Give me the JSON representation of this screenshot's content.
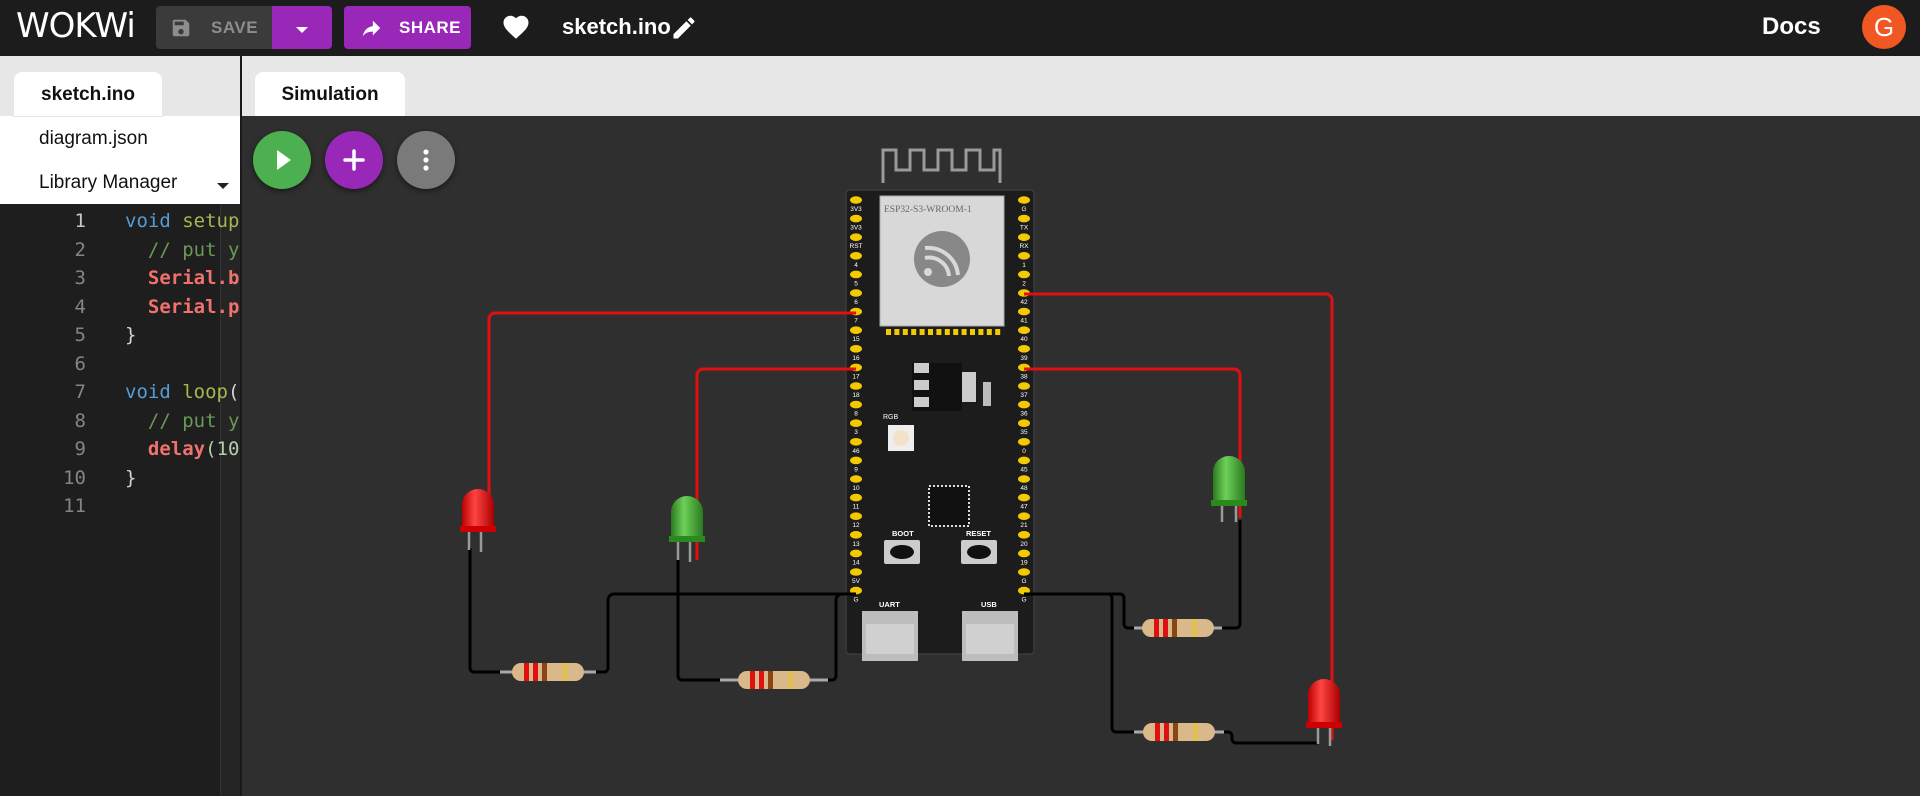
{
  "header": {
    "logo": "WOKWi",
    "save_label": "SAVE",
    "share_label": "SHARE",
    "project_name": "sketch.ino",
    "docs_label": "Docs",
    "avatar_letter": "G"
  },
  "editor": {
    "tabs": [
      {
        "label": "sketch.ino"
      },
      {
        "label": "diagram.json"
      },
      {
        "label": "Library Manager"
      }
    ],
    "line_numbers": [
      "1",
      "2",
      "3",
      "4",
      "5",
      "6",
      "7",
      "8",
      "9",
      "10",
      "11"
    ],
    "lines": [
      {
        "parts": [
          {
            "t": "void ",
            "c": "kw"
          },
          {
            "t": "setup",
            "c": "fn"
          }
        ]
      },
      {
        "parts": [
          {
            "t": "  // put y",
            "c": "cm"
          }
        ]
      },
      {
        "parts": [
          {
            "t": "  "
          },
          {
            "t": "Serial.b",
            "c": "obj"
          }
        ]
      },
      {
        "parts": [
          {
            "t": "  "
          },
          {
            "t": "Serial.p",
            "c": "obj"
          }
        ]
      },
      {
        "parts": [
          {
            "t": "}"
          }
        ]
      },
      {
        "parts": []
      },
      {
        "parts": [
          {
            "t": "void ",
            "c": "kw"
          },
          {
            "t": "loop",
            "c": "fn"
          },
          {
            "t": "("
          }
        ]
      },
      {
        "parts": [
          {
            "t": "  // put y",
            "c": "cm"
          }
        ]
      },
      {
        "parts": [
          {
            "t": "  "
          },
          {
            "t": "delay",
            "c": "obj"
          },
          {
            "t": "(10",
            "c": "num"
          }
        ]
      },
      {
        "parts": [
          {
            "t": "}"
          }
        ]
      },
      {
        "parts": []
      }
    ]
  },
  "simulation": {
    "tab_label": "Simulation",
    "board": {
      "module_label": "ESP32-S3-WROOM-1",
      "rgb_label": "RGB",
      "boot_label": "BOOT",
      "reset_label": "RESET",
      "uart_label": "UART",
      "usb_label": "USB",
      "left_pins": [
        "3V3",
        "3V3",
        "RST",
        "4",
        "5",
        "6",
        "7",
        "15",
        "16",
        "17",
        "18",
        "8",
        "3",
        "46",
        "9",
        "10",
        "11",
        "12",
        "13",
        "14",
        "5V",
        "G"
      ],
      "right_pins": [
        "G",
        "TX",
        "RX",
        "1",
        "2",
        "42",
        "41",
        "40",
        "39",
        "38",
        "37",
        "36",
        "35",
        "0",
        "45",
        "48",
        "47",
        "21",
        "20",
        "19",
        "G",
        "G"
      ]
    },
    "leds": [
      {
        "color": "red"
      },
      {
        "color": "green"
      },
      {
        "color": "green"
      },
      {
        "color": "red"
      }
    ]
  },
  "colors": {
    "accent_purple": "#9928b8",
    "play_green": "#4caf50",
    "avatar_orange": "#f05722",
    "wire_red": "#e01010",
    "wire_black": "#000000"
  },
  "icons": [
    "save-icon",
    "chevron-down-icon",
    "share-icon",
    "heart-icon",
    "pencil-icon",
    "play-icon",
    "plus-icon",
    "more-vert-icon"
  ]
}
